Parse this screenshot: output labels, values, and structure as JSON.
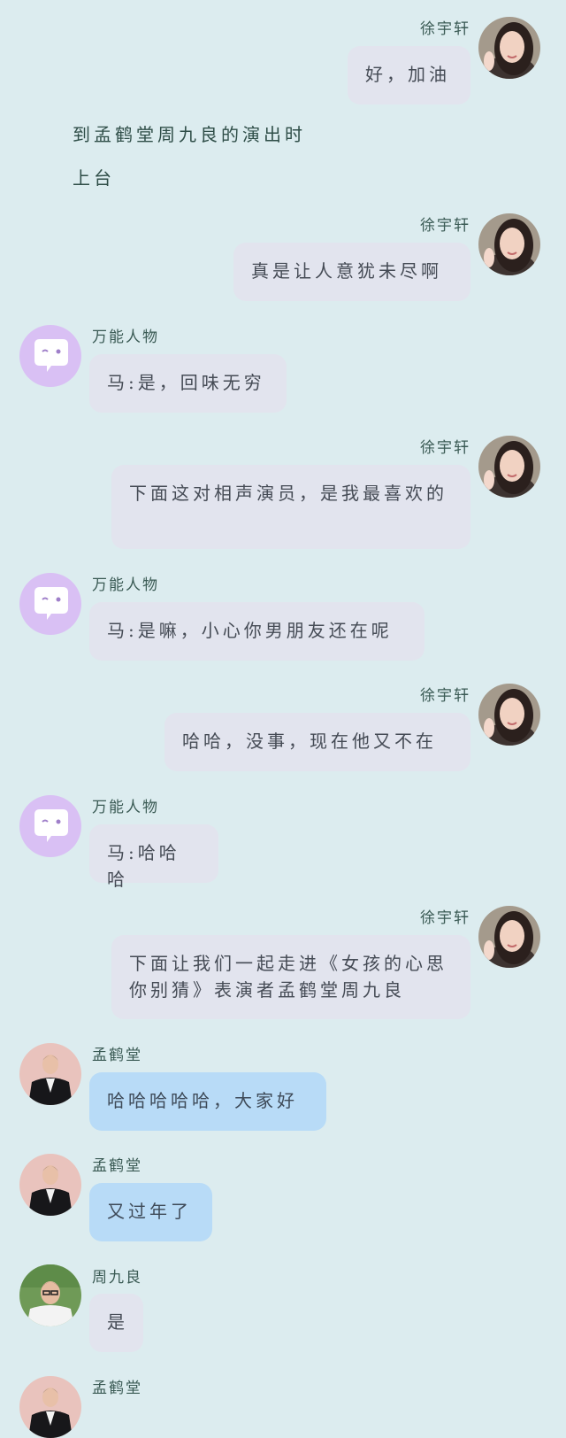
{
  "chat": {
    "m1": {
      "name": "徐宇轩",
      "text": "好，加油"
    },
    "narration": [
      "到孟鹤堂周九良的演出时",
      "上台"
    ],
    "m2": {
      "name": "徐宇轩",
      "text": "真是让人意犹未尽啊"
    },
    "m3": {
      "name": "万能人物",
      "text": "马:是，回味无穷"
    },
    "m4": {
      "name": "徐宇轩",
      "text": "下面这对相声演员，是我最喜欢的"
    },
    "m5": {
      "name": "万能人物",
      "text": "马:是嘛，小心你男朋友还在呢"
    },
    "m6": {
      "name": "徐宇轩",
      "text": "哈哈，没事，现在他又不在"
    },
    "m7": {
      "name": "万能人物",
      "text": "马:哈哈哈"
    },
    "m8": {
      "name": "徐宇轩",
      "text": "下面让我们一起走进《女孩的心思你别猜》表演者孟鹤堂周九良"
    },
    "m9": {
      "name": "孟鹤堂",
      "text": "哈哈哈哈哈，大家好"
    },
    "m10": {
      "name": "孟鹤堂",
      "text": "又过年了"
    },
    "m11": {
      "name": "周九良",
      "text": "是"
    },
    "m12": {
      "name": "孟鹤堂"
    }
  },
  "icons": {
    "xu": "woman-avatar",
    "wanneng": "chat-bubble-avatar",
    "meng": "man-suit-avatar",
    "zhou": "man-glasses-avatar"
  },
  "colors": {
    "background": "#dcecef",
    "bubble_gray": "#e2e4ee",
    "bubble_blue": "#b8dbf7",
    "avatar_purple": "#d9c0f4"
  }
}
